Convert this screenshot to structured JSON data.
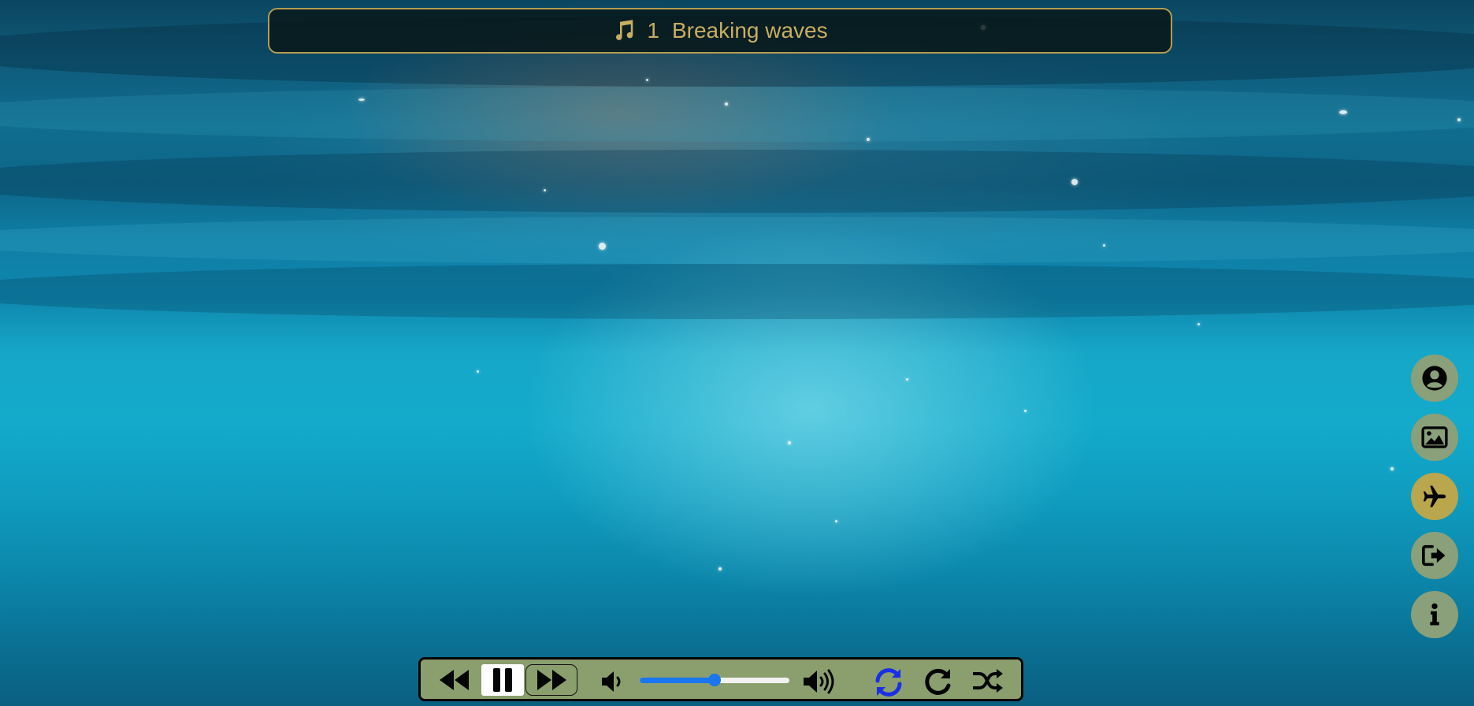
{
  "now_playing": {
    "track_number": "1",
    "track_title": "Breaking waves",
    "icon": "music-note-icon"
  },
  "side_menu": [
    {
      "name": "profile",
      "icon": "user-circle-icon"
    },
    {
      "name": "gallery",
      "icon": "image-icon"
    },
    {
      "name": "travel",
      "icon": "airplane-icon",
      "active": true
    },
    {
      "name": "logout",
      "icon": "sign-out-icon"
    },
    {
      "name": "info",
      "icon": "info-icon"
    }
  ],
  "player": {
    "controls": [
      "rewind-icon",
      "pause-icon",
      "fast-forward-icon",
      "volume-low-icon",
      "volume-high-icon",
      "repeat-all-icon",
      "repeat-one-icon",
      "shuffle-icon"
    ],
    "volume": 0.5,
    "repeat_all_active": true,
    "playing": true
  },
  "colors": {
    "title_text": "#c9ad62",
    "title_border": "#b39b52",
    "side_button": "#8aa07a",
    "side_button_active": "#b9a64d",
    "player_bg": "#8a9e6e",
    "accent_blue": "#1976f0",
    "repeat_active": "#1a2ee8"
  }
}
